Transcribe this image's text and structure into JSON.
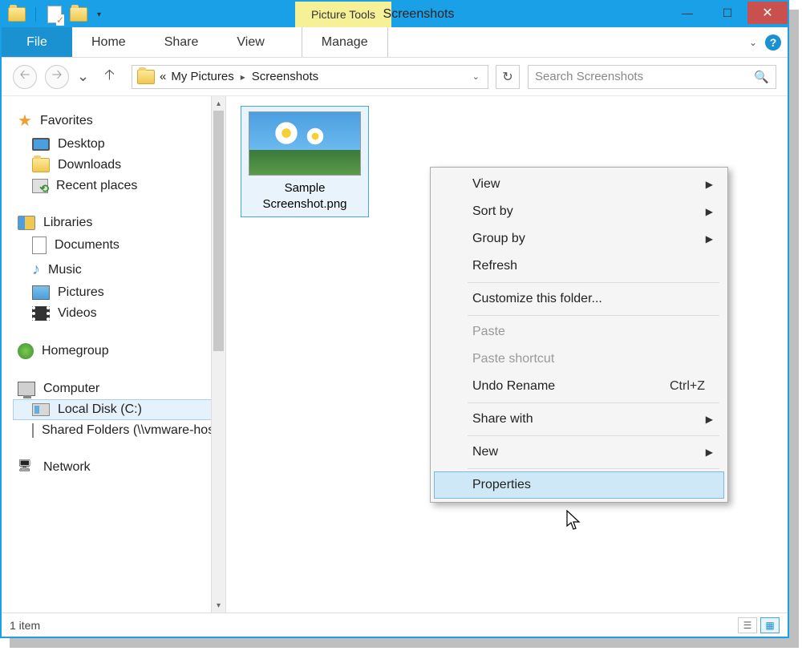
{
  "titlebar": {
    "tool_context": "Picture Tools",
    "window_title": "Screenshots"
  },
  "ribbon": {
    "file": "File",
    "tabs": [
      "Home",
      "Share",
      "View"
    ],
    "manage": "Manage"
  },
  "address": {
    "seg_prefix": "«",
    "seg1": "My Pictures",
    "seg2": "Screenshots",
    "search_placeholder": "Search Screenshots"
  },
  "sidebar": {
    "favorites": {
      "header": "Favorites",
      "items": [
        "Desktop",
        "Downloads",
        "Recent places"
      ]
    },
    "libraries": {
      "header": "Libraries",
      "items": [
        "Documents",
        "Music",
        "Pictures",
        "Videos"
      ]
    },
    "homegroup": {
      "header": "Homegroup"
    },
    "computer": {
      "header": "Computer",
      "items": [
        "Local Disk (C:)",
        "Shared Folders (\\\\vmware-host) (Z:)"
      ]
    },
    "network": {
      "header": "Network"
    }
  },
  "content": {
    "file_name": "Sample Screenshot.png"
  },
  "context_menu": {
    "view": "View",
    "sort": "Sort by",
    "group": "Group by",
    "refresh": "Refresh",
    "customize": "Customize this folder...",
    "paste": "Paste",
    "paste_shortcut": "Paste shortcut",
    "undo": "Undo Rename",
    "undo_key": "Ctrl+Z",
    "share": "Share with",
    "new": "New",
    "properties": "Properties"
  },
  "status": {
    "count": "1 item"
  }
}
